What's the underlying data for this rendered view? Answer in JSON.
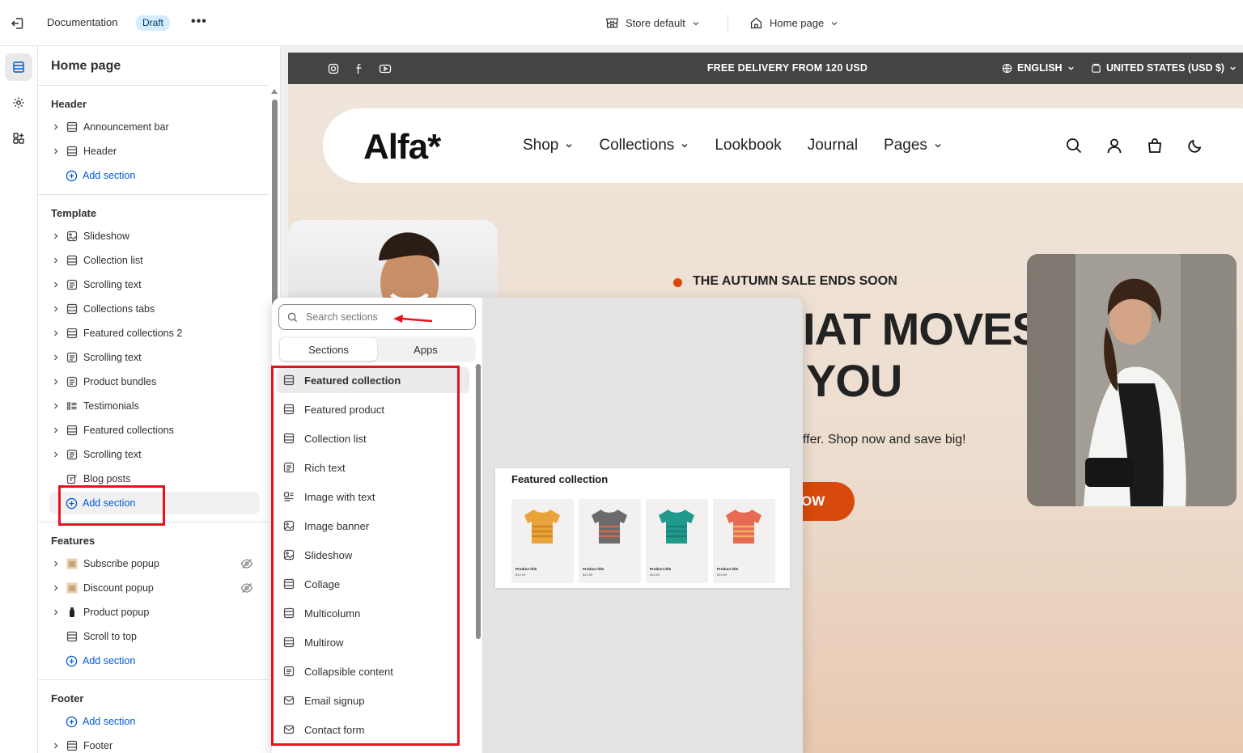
{
  "topbar": {
    "title": "Documentation",
    "badge": "Draft",
    "more": "•••",
    "store": "Store default",
    "page": "Home page"
  },
  "sidebar": {
    "title": "Home page",
    "groups": {
      "header": {
        "title": "Header",
        "items": [
          {
            "label": "Announcement bar",
            "icon": "section-icon"
          },
          {
            "label": "Header",
            "icon": "section-icon"
          }
        ],
        "add": "Add section"
      },
      "template": {
        "title": "Template",
        "items": [
          {
            "label": "Slideshow",
            "icon": "slideshow-icon"
          },
          {
            "label": "Collection list",
            "icon": "section-icon"
          },
          {
            "label": "Scrolling text",
            "icon": "text-icon"
          },
          {
            "label": "Collections tabs",
            "icon": "section-icon"
          },
          {
            "label": "Featured collections 2",
            "icon": "section-icon"
          },
          {
            "label": "Scrolling text",
            "icon": "text-icon"
          },
          {
            "label": "Product bundles",
            "icon": "text-icon"
          },
          {
            "label": "Testimonials",
            "icon": "testimonials-icon"
          },
          {
            "label": "Featured collections",
            "icon": "section-icon"
          },
          {
            "label": "Scrolling text",
            "icon": "text-icon"
          },
          {
            "label": "Blog posts",
            "icon": "blog-icon"
          }
        ],
        "add": "Add section"
      },
      "features": {
        "title": "Features",
        "items": [
          {
            "label": "Subscribe popup",
            "icon": "image-thumb-icon",
            "hidden": true
          },
          {
            "label": "Discount popup",
            "icon": "image-thumb-icon",
            "hidden": true
          },
          {
            "label": "Product popup",
            "icon": "bottle-thumb-icon",
            "hidden": false
          },
          {
            "label": "Scroll to top",
            "icon": "section-icon",
            "hidden": false
          }
        ],
        "add": "Add section"
      },
      "footer": {
        "title": "Footer",
        "add": "Add section",
        "items": [
          {
            "label": "Footer",
            "icon": "section-icon"
          }
        ]
      }
    }
  },
  "preview": {
    "announcement": "FREE DELIVERY FROM 120 USD",
    "language": "ENGLISH",
    "country": "UNITED STATES (USD $)",
    "logo": "Alfa*",
    "nav": [
      "Shop",
      "Collections",
      "Lookbook",
      "Journal",
      "Pages"
    ],
    "sale": "THE AUTUMN SALE ENDS SOON",
    "headline_line1": "IAT MOVES",
    "headline_line2": "YOU",
    "body": "ffer. Shop now and save big!",
    "button": "OW"
  },
  "popover": {
    "search_placeholder": "Search sections",
    "tabs": [
      "Sections",
      "Apps"
    ],
    "active_tab": "Sections",
    "items": [
      "Featured collection",
      "Featured product",
      "Collection list",
      "Rich text",
      "Image with text",
      "Image banner",
      "Slideshow",
      "Collage",
      "Multicolumn",
      "Multirow",
      "Collapsible content",
      "Email signup",
      "Contact form"
    ],
    "active_item": "Featured collection",
    "preview": {
      "title": "Featured collection",
      "products": [
        {
          "title": "Product title",
          "price": "$19.99",
          "color": "#e8a33a",
          "stripe": "#c77f1e"
        },
        {
          "title": "Product title",
          "price": "$19.99",
          "color": "#6b6b6b",
          "stripe": "#e56b4a"
        },
        {
          "title": "Product title",
          "price": "$19.99",
          "color": "#1f9a8c",
          "stripe": "#177a6f"
        },
        {
          "title": "Product title",
          "price": "$19.99",
          "color": "#e76a55",
          "stripe": "#f2c36b"
        }
      ]
    }
  },
  "colors": {
    "accent": "#005bd3",
    "annotation_red": "#e8111c",
    "hero_button": "#d84a0c",
    "announcement_bg": "#444444"
  }
}
